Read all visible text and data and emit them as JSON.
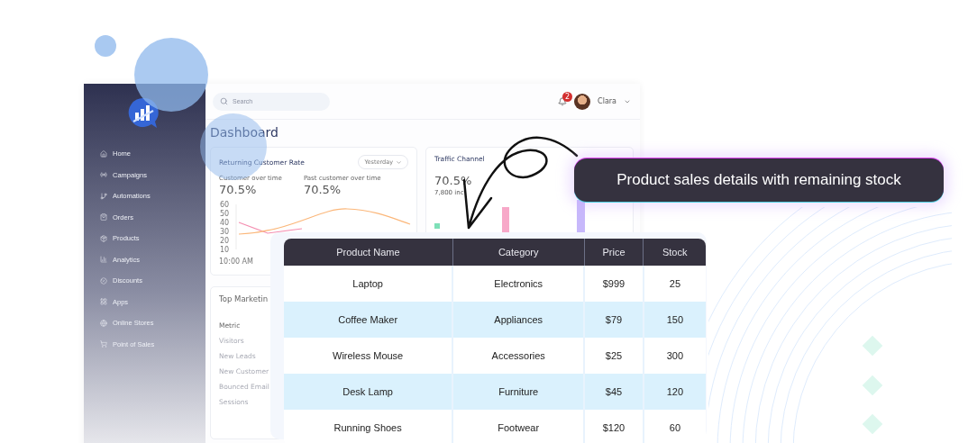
{
  "callout": {
    "text": "Product sales details with remaining stock"
  },
  "sidebar": {
    "items": [
      {
        "label": "Home"
      },
      {
        "label": "Campaigns"
      },
      {
        "label": "Automations"
      },
      {
        "label": "Orders"
      },
      {
        "label": "Products"
      },
      {
        "label": "Analytics"
      },
      {
        "label": "Discounts"
      },
      {
        "label": "Apps"
      },
      {
        "label": "Online Stores"
      },
      {
        "label": "Point of Sales"
      }
    ]
  },
  "header": {
    "search": {
      "placeholder": "Search"
    },
    "notifications": "2",
    "user": "Clara"
  },
  "page_title": "Dashboard",
  "returning_card": {
    "title": "Returning Customer Rate",
    "period": "Yesterday",
    "stats": [
      {
        "label": "Customer over time",
        "value": "70.5%"
      },
      {
        "label": "Past customer over time",
        "value": "70.5%"
      }
    ],
    "y_axis_labels": [
      "60",
      "50",
      "40",
      "30",
      "20",
      "10"
    ],
    "x_axis_label": "10:00 AM"
  },
  "traffic_card": {
    "title": "Traffic Channel",
    "value": "70.5%",
    "note": "7,800 inc"
  },
  "marketing_card": {
    "title": "Top Marketin",
    "header": "Metric",
    "rows": [
      "Visitors",
      "New Leads",
      "New Customer",
      "Bounced Email",
      "Sessions"
    ]
  },
  "table": {
    "columns": [
      "Product Name",
      "Category",
      "Price",
      "Stock"
    ],
    "rows": [
      [
        "Laptop",
        "Electronics",
        "$999",
        "25"
      ],
      [
        "Coffee Maker",
        "Appliances",
        "$79",
        "150"
      ],
      [
        "Wireless Mouse",
        "Accessories",
        "$25",
        "300"
      ],
      [
        "Desk Lamp",
        "Furniture",
        "$45",
        "120"
      ],
      [
        "Running Shoes",
        "Footwear",
        "$120",
        "60"
      ]
    ]
  }
}
